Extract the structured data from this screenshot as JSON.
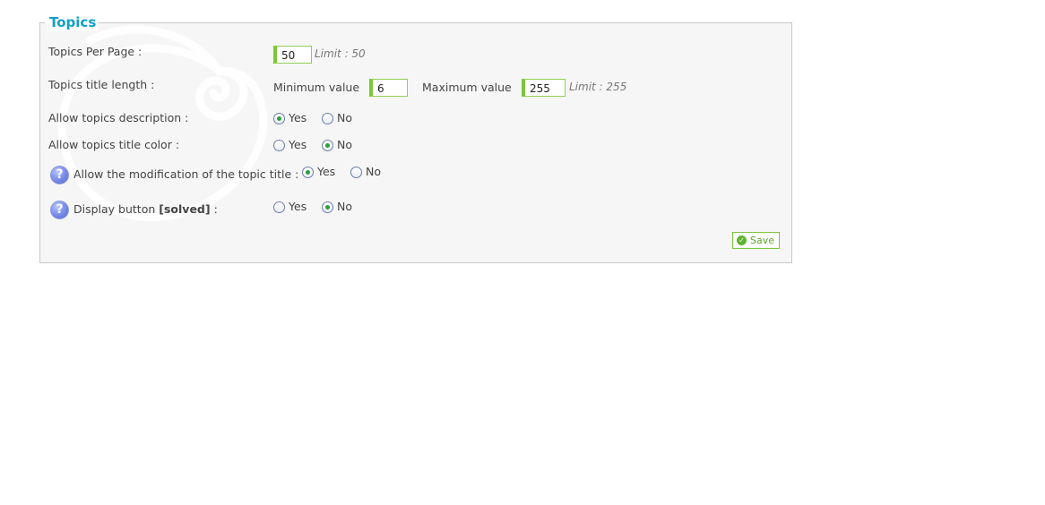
{
  "fieldset": {
    "legend": "Topics"
  },
  "rows": {
    "per_page": {
      "label": "Topics Per Page :",
      "value": "50",
      "hint": "Limit : 50"
    },
    "title_length": {
      "label": "Topics title length :",
      "min_label": "Minimum value",
      "min_value": "6",
      "max_label": "Maximum value",
      "max_value": "255",
      "hint": "Limit : 255"
    },
    "description": {
      "label": "Allow topics description :",
      "yes": "Yes",
      "no": "No",
      "selected": "yes"
    },
    "title_color": {
      "label": "Allow topics title color :",
      "yes": "Yes",
      "no": "No",
      "selected": "no"
    },
    "modify_title": {
      "label": "Allow the modification of the topic title :",
      "yes": "Yes",
      "no": "No",
      "selected": "yes"
    },
    "solved_button": {
      "label_prefix": "Display button",
      "label_bold": "[solved]",
      "label_suffix": ":",
      "yes": "Yes",
      "no": "No",
      "selected": "no"
    }
  },
  "help_icon": {
    "glyph": "?"
  },
  "save_button": {
    "label": "Save"
  },
  "colors": {
    "legend": "#0fa0c8",
    "accent": "#7cc63a",
    "panel_bg": "#f6f6f6"
  }
}
